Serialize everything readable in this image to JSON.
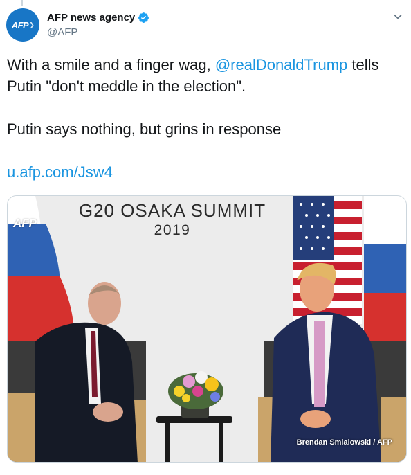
{
  "author": {
    "name": "AFP news agency",
    "handle": "@AFP",
    "avatar_text": "AFP",
    "avatar_color": "#1876c6",
    "verified": true
  },
  "tweet": {
    "line1_prefix": "With a smile and a finger wag, ",
    "mention": "@realDonaldTrump",
    "line1_suffix": " tells Putin \"don't meddle in the election\".",
    "line2": "Putin says nothing, but grins in response",
    "url": "u.afp.com/Jsw4",
    "link_color": "#1b95e0"
  },
  "media": {
    "backdrop_title": "G20 OSAKA SUMMIT",
    "backdrop_year": "2019",
    "watermark": "AFP",
    "credit": "Brendan Smialowski / AFP"
  },
  "icons": [
    "verified-badge-icon",
    "chevron-down-icon"
  ]
}
